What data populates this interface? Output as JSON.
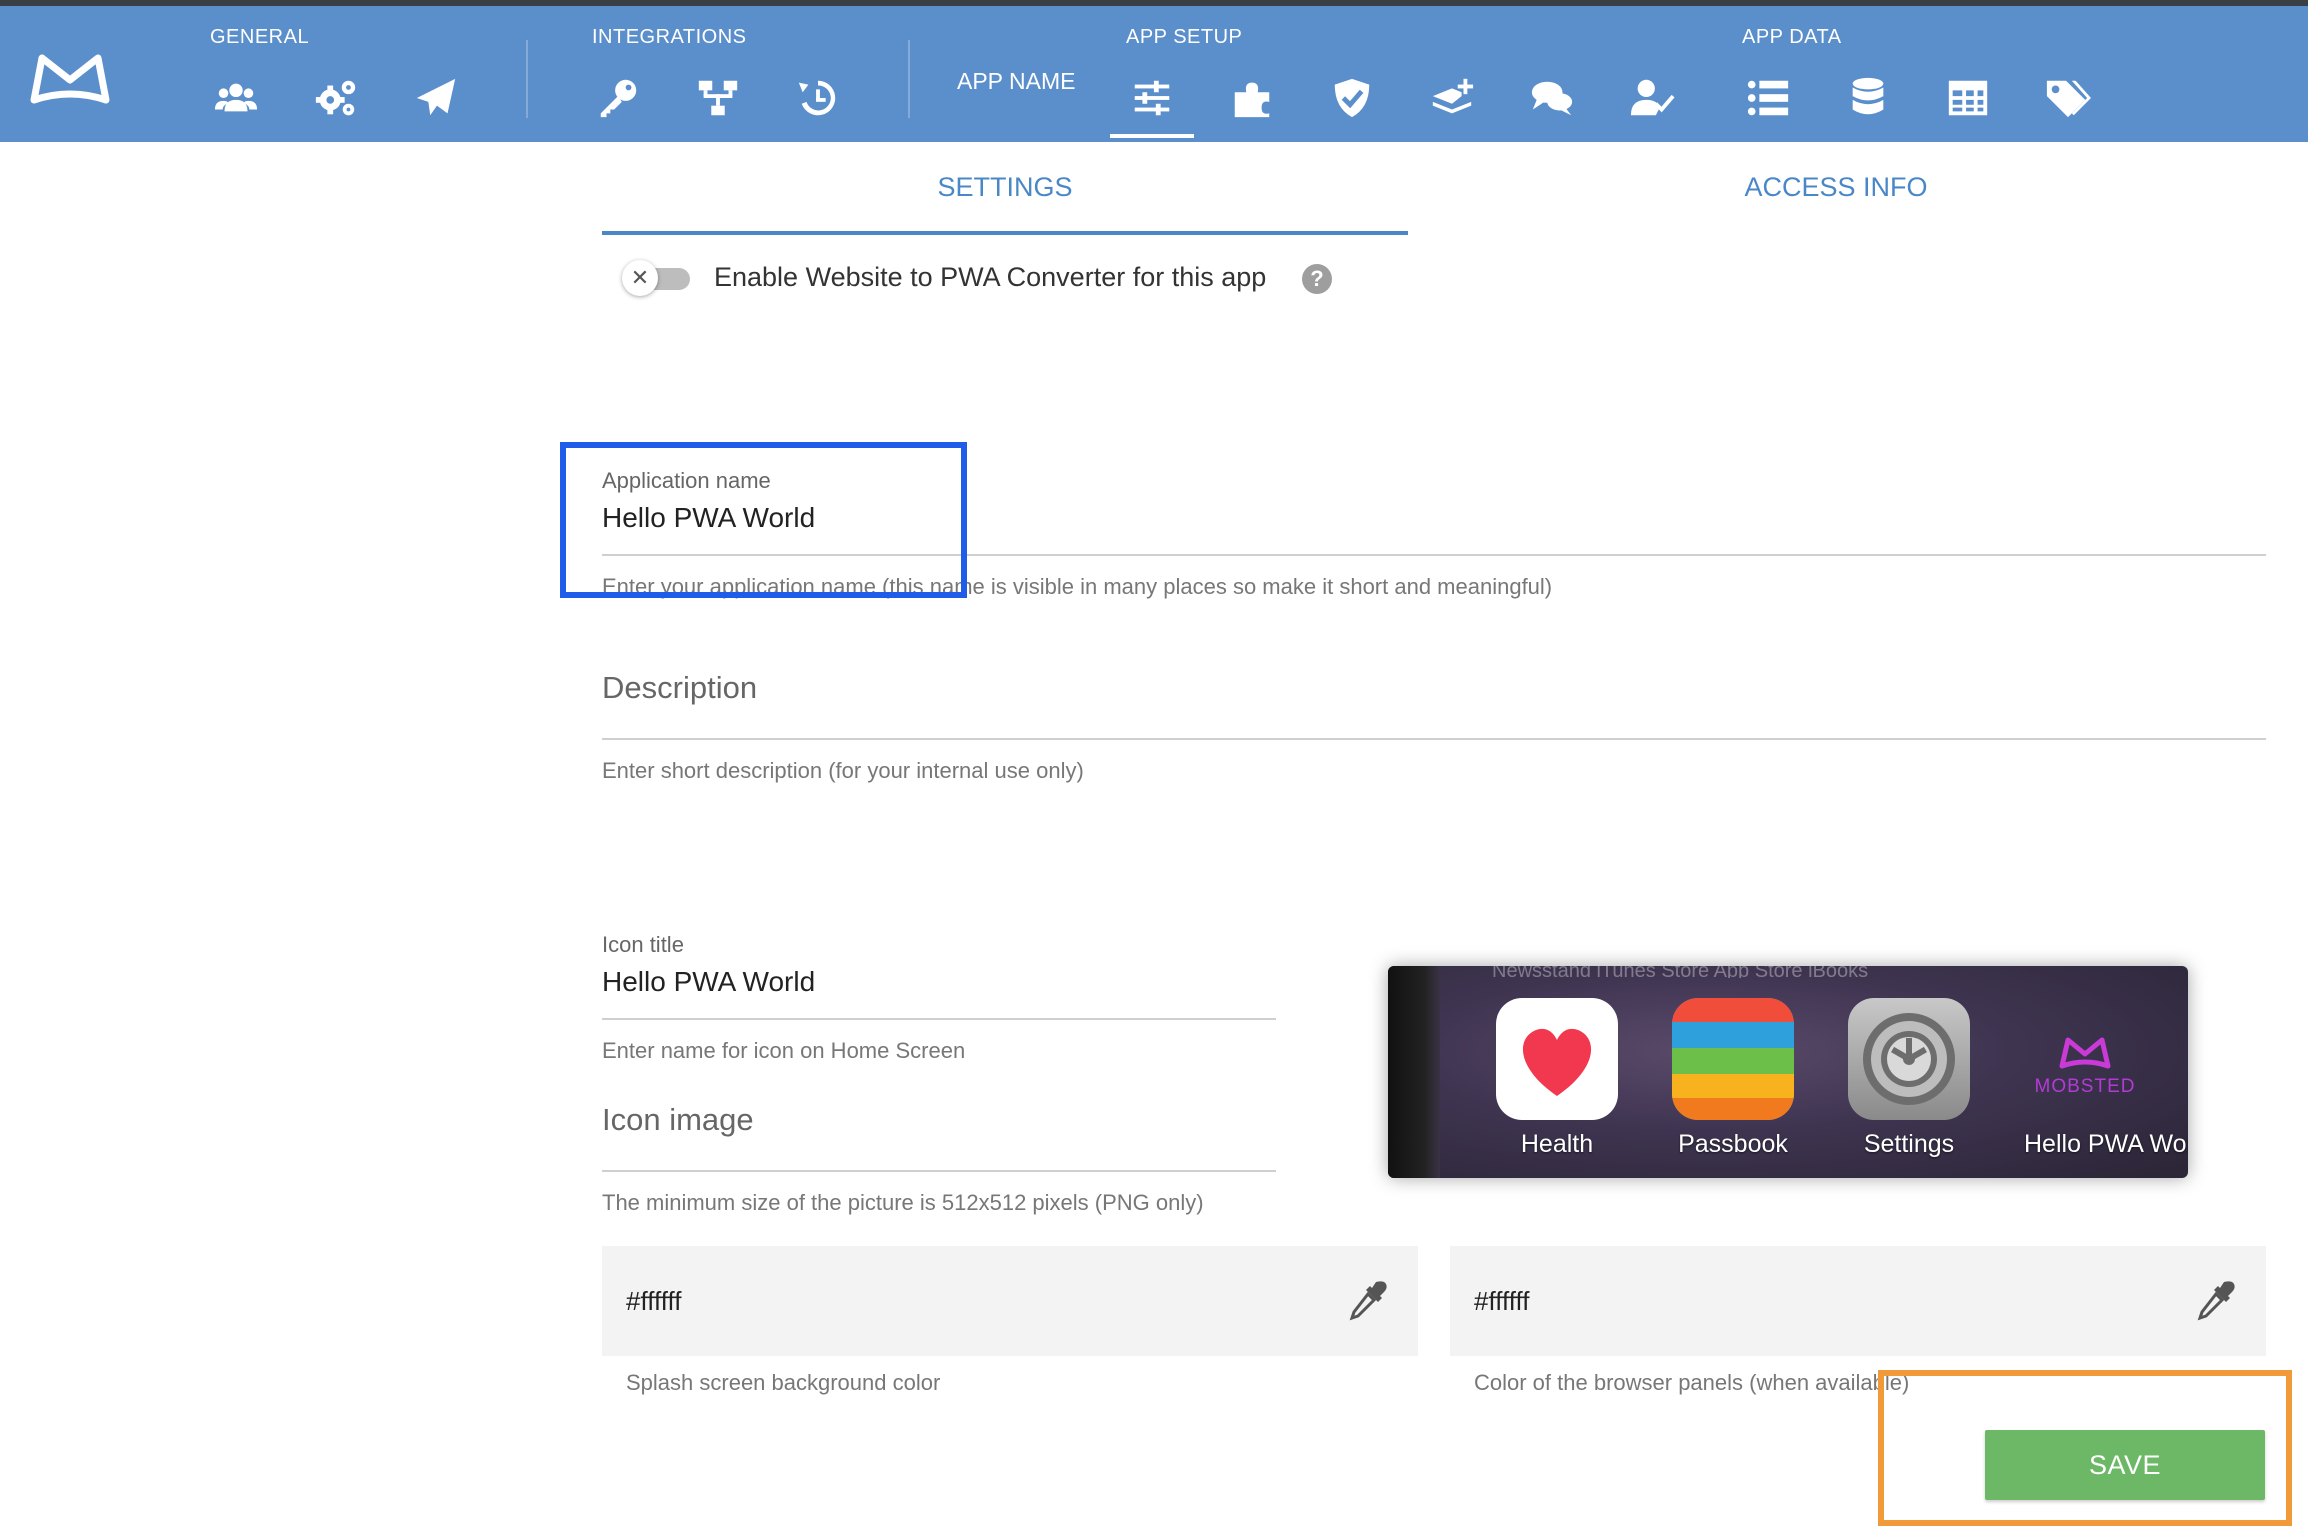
{
  "nav": {
    "sections": {
      "general": "GENERAL",
      "integrations": "INTEGRATIONS",
      "app_setup": "APP SETUP",
      "app_data": "APP DATA"
    },
    "app_name_label": "APP NAME",
    "icons": [
      "users-icon",
      "cogs-icon",
      "paper-plane-icon",
      "key-icon",
      "sitemap-icon",
      "history-icon",
      "sliders-icon",
      "puzzle-icon",
      "shield-check-icon",
      "layers-plus-icon",
      "chat-icon",
      "user-check-icon",
      "list-icon",
      "database-icon",
      "table-icon",
      "tags-icon"
    ],
    "active_icon": "sliders-icon"
  },
  "tabs": {
    "settings": "SETTINGS",
    "access_info": "ACCESS INFO",
    "active": "settings"
  },
  "pwa_toggle": {
    "label": "Enable Website to PWA Converter for this app",
    "enabled": false,
    "help": "?"
  },
  "form": {
    "app_name": {
      "label": "Application name",
      "value": "Hello PWA World",
      "hint": "Enter your application name (this name is visible in many places so make it short and meaningful)"
    },
    "description": {
      "placeholder": "Description",
      "hint": "Enter short description (for your internal use only)"
    },
    "icon_title": {
      "label": "Icon title",
      "value": "Hello PWA World",
      "hint": "Enter name for icon on Home Screen"
    },
    "icon_image": {
      "placeholder": "Icon image",
      "hint": "The minimum size of the picture is 512x512 pixels (PNG only)"
    },
    "splash_color": {
      "value": "#ffffff",
      "hint": "Splash screen background color"
    },
    "browser_color": {
      "value": "#ffffff",
      "hint": "Color of the browser panels (when available)"
    }
  },
  "preview": {
    "top_row": "Newsstand        iTunes Store        App Store        iBooks",
    "apps": [
      {
        "label": "Health"
      },
      {
        "label": "Passbook"
      },
      {
        "label": "Settings"
      },
      {
        "label": "Hello PWA World",
        "logo_text": "MOBSTED"
      }
    ]
  },
  "save_label": "SAVE",
  "colors": {
    "header": "#5b8fcb",
    "accent": "#4a87c7",
    "save": "#6db866",
    "highlight_blue": "#1f5de8",
    "highlight_orange": "#f09a3a"
  }
}
